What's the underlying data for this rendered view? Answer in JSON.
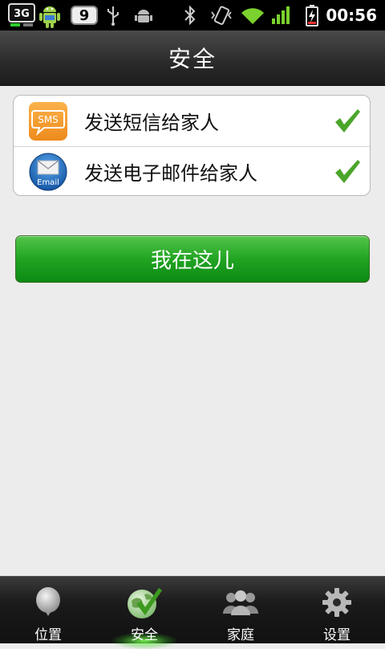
{
  "status_bar": {
    "network_label": "3G",
    "notification_count": "9",
    "time": "00:56",
    "icons": [
      "3g-icon",
      "android-icon",
      "notification-count-badge",
      "usb-icon",
      "debug-icon",
      "bluetooth-icon",
      "vibrate-icon",
      "wifi-icon",
      "signal-icon",
      "battery-charging-icon"
    ]
  },
  "header": {
    "title": "安全"
  },
  "options": [
    {
      "icon": "sms-icon",
      "icon_text": "SMS",
      "label": "发送短信给家人",
      "checked": true
    },
    {
      "icon": "email-icon",
      "icon_text": "Email",
      "label": "发送电子邮件给家人",
      "checked": true
    }
  ],
  "main_button": {
    "label": "我在这儿"
  },
  "tabs": [
    {
      "label": "位置",
      "icon": "location-balloon-icon",
      "selected": false
    },
    {
      "label": "安全",
      "icon": "safety-globe-check-icon",
      "selected": true
    },
    {
      "label": "家庭",
      "icon": "family-people-icon",
      "selected": false
    },
    {
      "label": "设置",
      "icon": "gear-icon",
      "selected": false
    }
  ],
  "colors": {
    "accent_green": "#22a422",
    "check_green": "#4aa52a",
    "sms_orange": "#f29a2e",
    "email_blue": "#1f72c6"
  }
}
